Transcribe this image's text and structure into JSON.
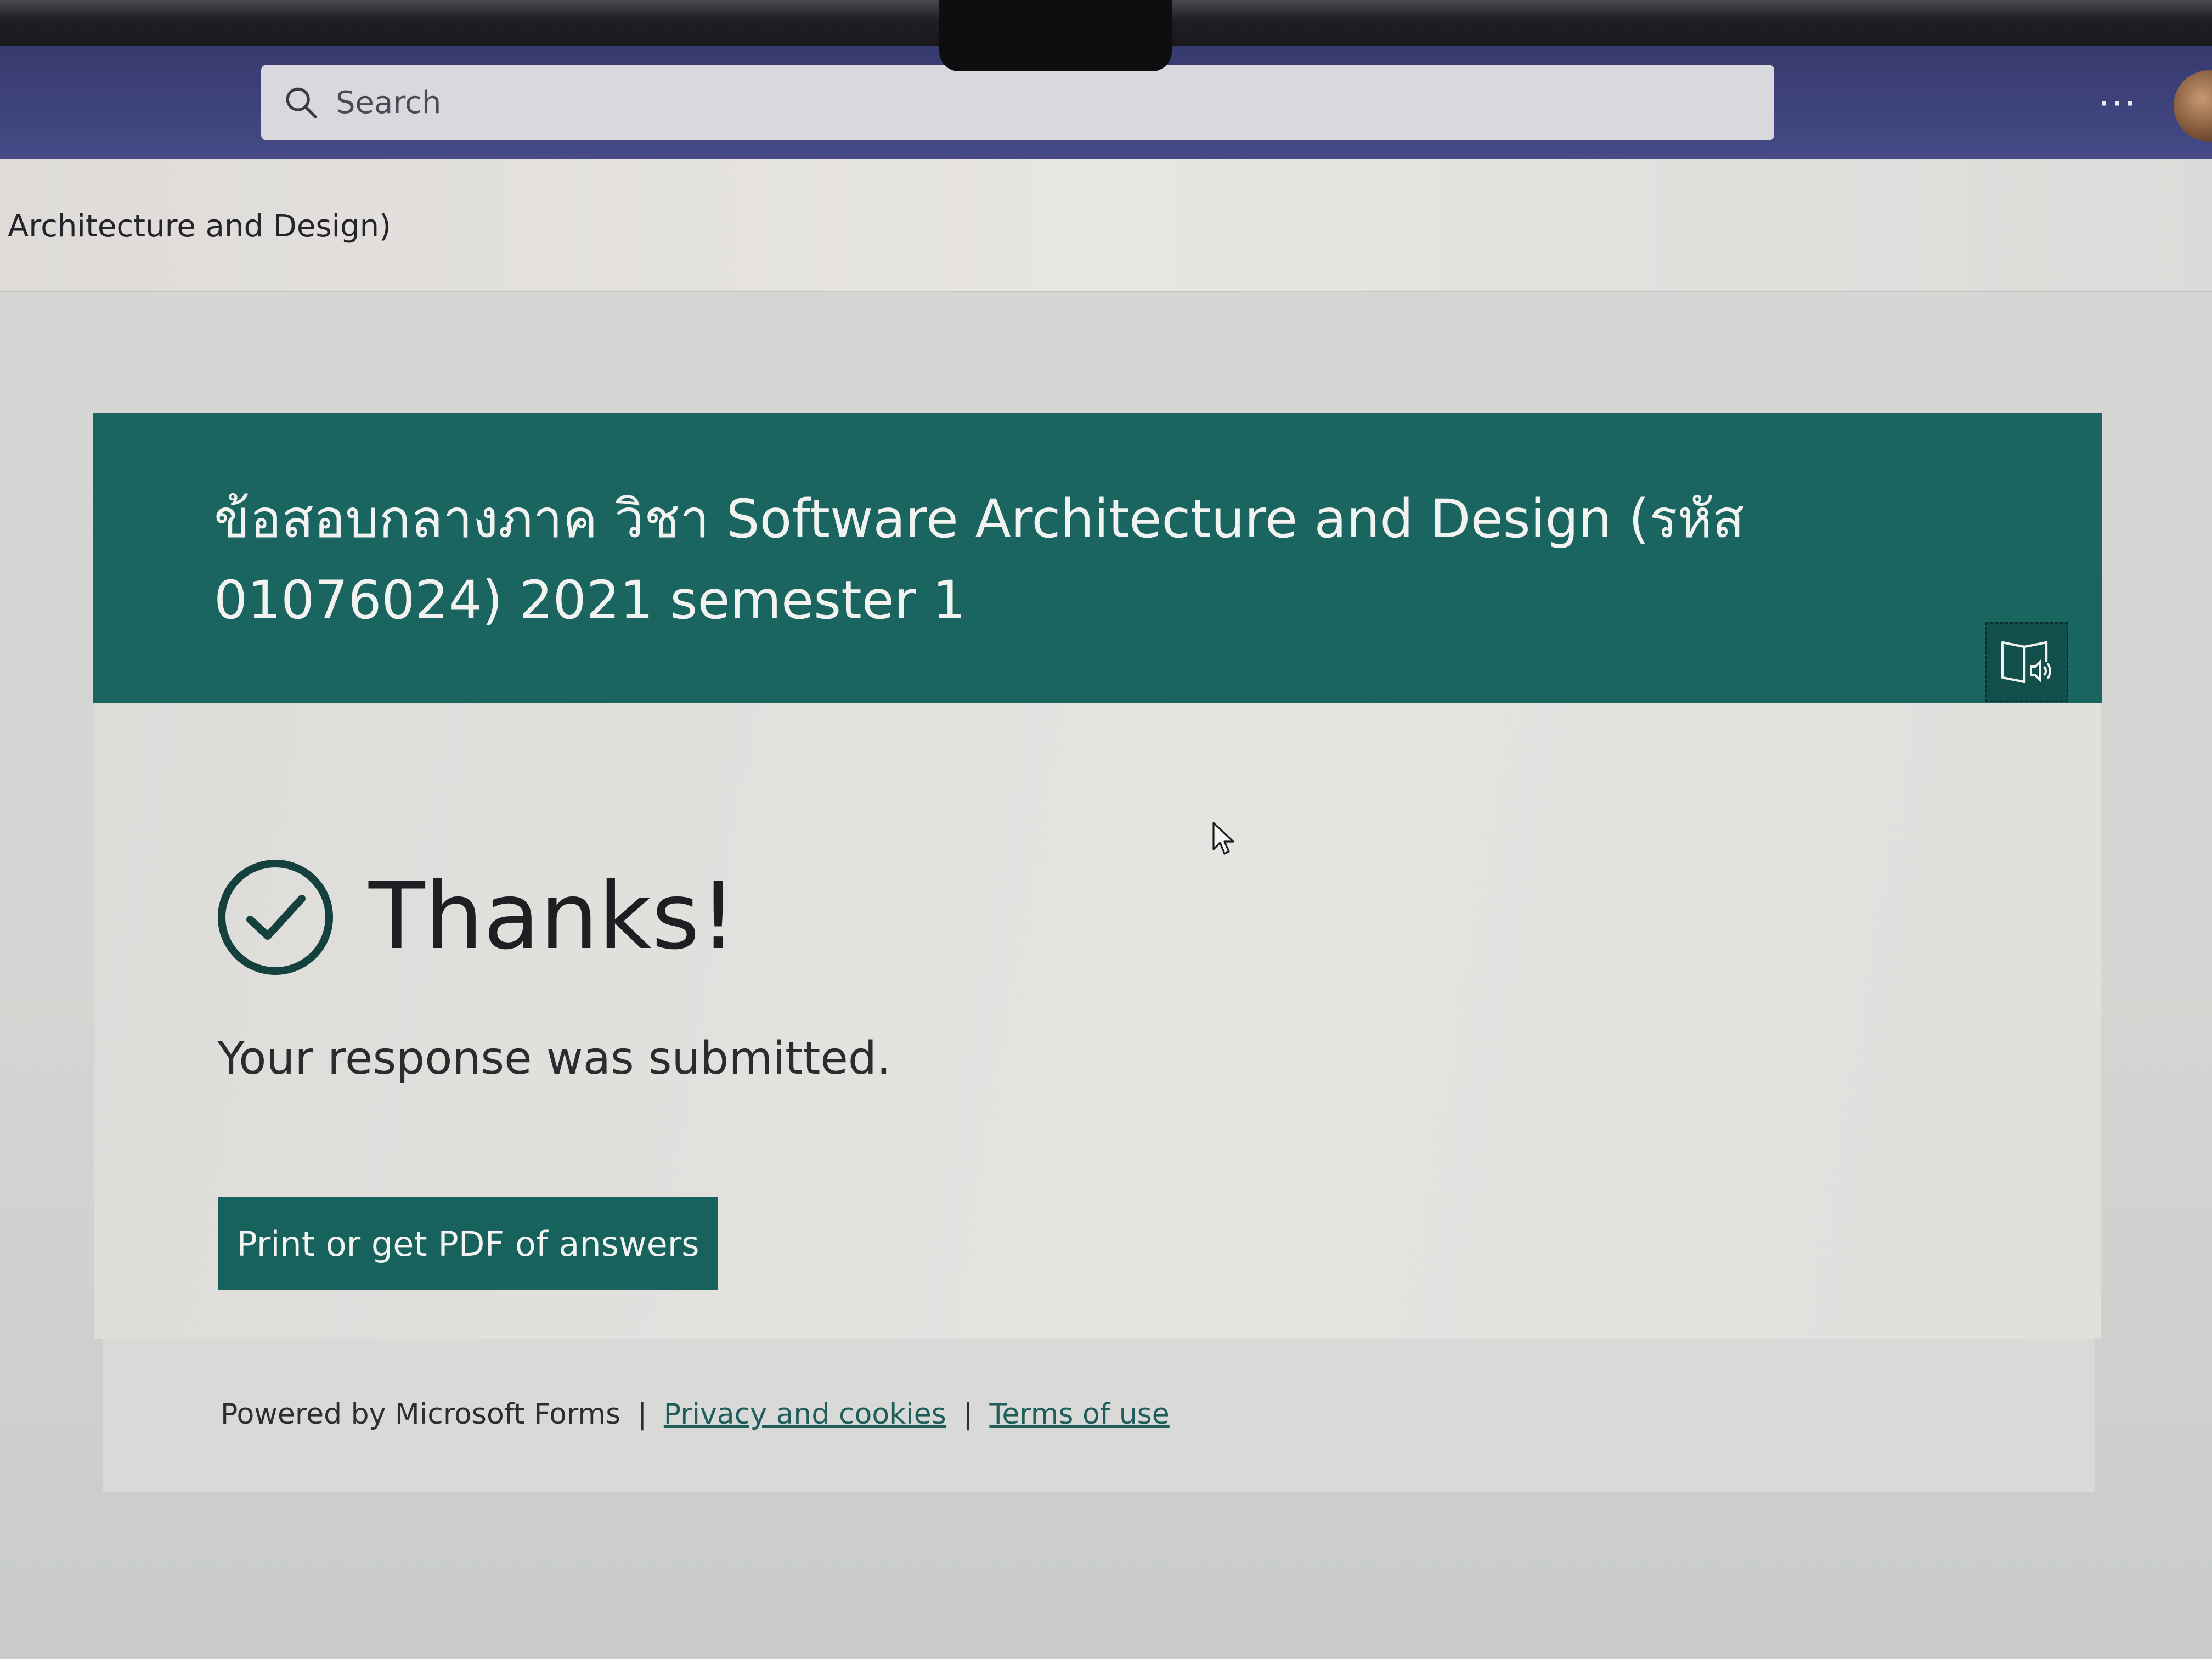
{
  "search": {
    "placeholder": "Search"
  },
  "topbar": {
    "more_label": "···"
  },
  "tab": {
    "title": "Architecture and Design)"
  },
  "form": {
    "title": "ข้อสอบกลางภาค วิชา Software Architecture and Design (รหัส 01076024) 2021 semester 1",
    "header_color": "#1a6560"
  },
  "confirmation": {
    "heading": "Thanks!",
    "message": "Your response was submitted.",
    "print_button_label": "Print or get PDF of answers"
  },
  "footer": {
    "powered_by": "Powered by Microsoft Forms",
    "separator": "|",
    "privacy_link": "Privacy and cookies",
    "terms_link": "Terms of use"
  },
  "icons": {
    "search": "search-icon",
    "check": "check-circle-icon",
    "immersive_reader": "immersive-reader-icon"
  }
}
